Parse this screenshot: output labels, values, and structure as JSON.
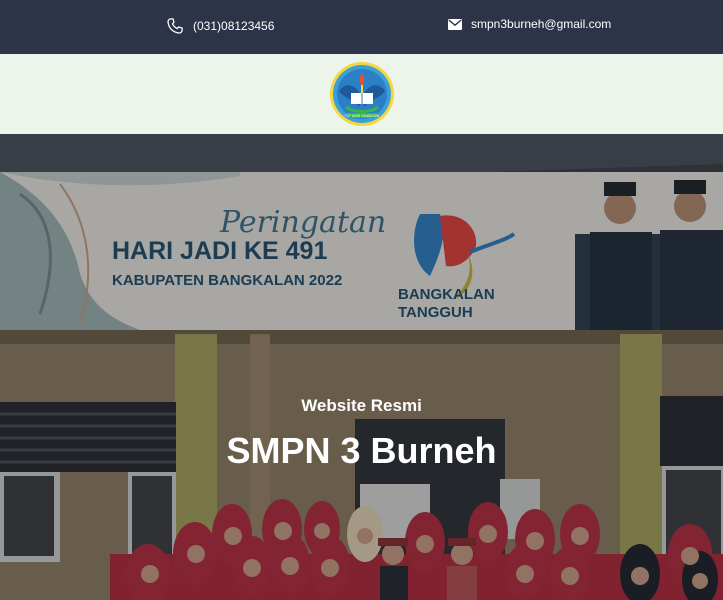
{
  "contact": {
    "phone": "(031)08123456",
    "email": "smpn3burneh@gmail.com"
  },
  "logo": {
    "name": "school-logo",
    "motto": "TUT WURI HANDAYANI"
  },
  "hero": {
    "subtitle": "Website Resmi",
    "title": "SMPN 3 Burneh",
    "banner": {
      "line1": "Peringatan",
      "line2": "HARI JADI KE 491",
      "line3": "KABUPATEN BANGKALAN 2022",
      "line4": "BANGKALAN",
      "line5": "TANGGUH"
    }
  },
  "colors": {
    "topbar": "#2e3447",
    "logobar": "#edf4ea",
    "text": "#ffffff"
  },
  "icons": {
    "phone": "phone-icon",
    "email": "envelope-icon"
  }
}
